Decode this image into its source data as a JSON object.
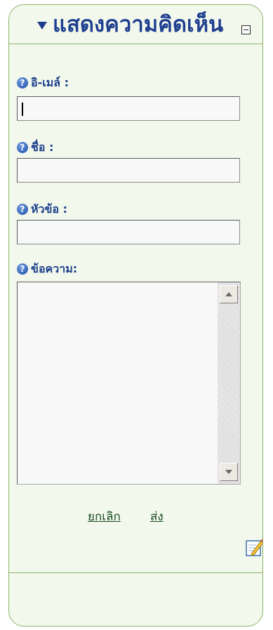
{
  "header": {
    "title": "แสดงความคิดเห็น",
    "toggle_icon": "triangle-down-icon",
    "collapse_icon": "minus-box-icon"
  },
  "form": {
    "email": {
      "label": "อิ-เมล์ :",
      "value": ""
    },
    "name": {
      "label": "ชื่อ :",
      "value": ""
    },
    "subject": {
      "label": "หัวข้อ :",
      "value": ""
    },
    "message": {
      "label": "ข้อความ:",
      "value": ""
    },
    "help_icon": "help-question-icon"
  },
  "actions": {
    "cancel_label": "ยกเลิก",
    "send_label": "ส่ง",
    "edit_icon": "edit-pencil-icon"
  },
  "colors": {
    "panel_border": "#8db56a",
    "panel_bg": "#f3f8ec",
    "title": "#1f3f8f",
    "label": "#1b3f8b",
    "link": "#154a1d"
  }
}
